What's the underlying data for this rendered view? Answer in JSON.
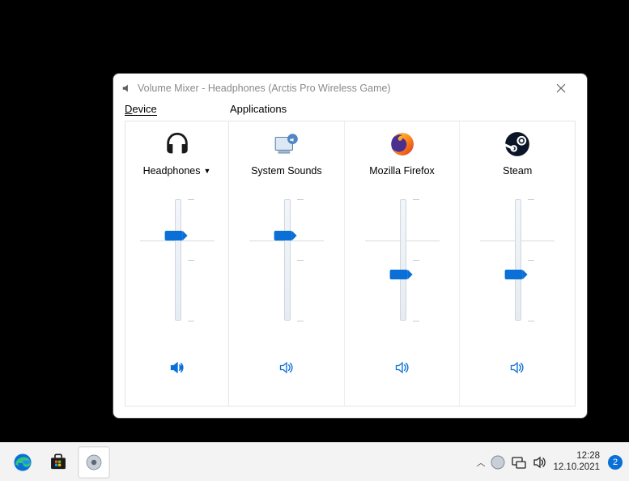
{
  "window": {
    "title": "Volume Mixer - Headphones (Arctis Pro Wireless Game)",
    "section_device": "Device",
    "section_apps": "Applications"
  },
  "device": {
    "label": "Headphones",
    "volume": 70,
    "icon": "headphones-icon"
  },
  "apps": [
    {
      "label": "System Sounds",
      "volume": 70,
      "icon": "system-sounds-icon"
    },
    {
      "label": "Mozilla Firefox",
      "volume": 38,
      "icon": "firefox-icon"
    },
    {
      "label": "Steam",
      "volume": 38,
      "icon": "steam-icon"
    }
  ],
  "taskbar": {
    "time": "12:28",
    "date": "12.10.2021",
    "notification_count": "2"
  }
}
